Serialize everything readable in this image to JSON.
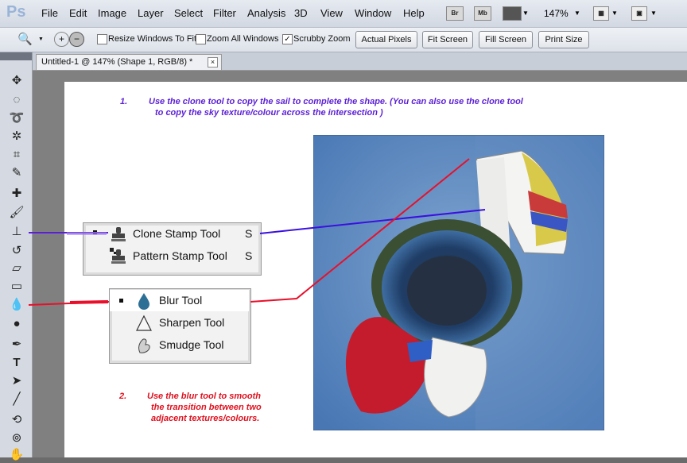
{
  "app": {
    "logo": "Ps",
    "menus": [
      "File",
      "Edit",
      "Image",
      "Layer",
      "Select",
      "Filter",
      "Analysis",
      "3D",
      "View",
      "Window",
      "Help"
    ],
    "bridge_label": "Br",
    "minibridge_label": "Mb",
    "zoom": "147%"
  },
  "options": {
    "resize_windows_label": "Resize Windows To Fit",
    "resize_windows_checked": false,
    "zoom_all_label": "Zoom All Windows",
    "zoom_all_checked": false,
    "scrubby_zoom_label": "Scrubby Zoom",
    "scrubby_zoom_checked": true,
    "actual_pixels_label": "Actual Pixels",
    "fit_screen_label": "Fit Screen",
    "fill_screen_label": "Fill Screen",
    "print_size_label": "Print Size"
  },
  "document": {
    "tab_title": "Untitled-1 @ 147% (Shape 1, RGB/8) *",
    "close_glyph": "×"
  },
  "notes": {
    "step1_number": "1.",
    "step1_line1": "Use the clone tool to copy the sail to complete the shape.  (You can also use the clone tool",
    "step1_line2": "to copy the sky texture/colour  across the intersection )",
    "step2_number": "2.",
    "step2_line1": "Use the blur tool to smooth",
    "step2_line2": "the transition between two",
    "step2_line3": "adjacent textures/colours."
  },
  "stamp_popup": {
    "items": [
      {
        "label": "Clone Stamp Tool",
        "key": "S",
        "selected": true
      },
      {
        "label": "Pattern Stamp Tool",
        "key": "S",
        "selected": false
      }
    ]
  },
  "blur_popup": {
    "items": [
      {
        "label": "Blur Tool",
        "selected": true
      },
      {
        "label": "Sharpen Tool",
        "selected": false
      },
      {
        "label": "Smudge Tool",
        "selected": false
      }
    ]
  },
  "colors": {
    "note1": "#5b1fd6",
    "note2": "#e0101e",
    "line_blue": "#3a10e0",
    "line_red": "#e8102a"
  }
}
